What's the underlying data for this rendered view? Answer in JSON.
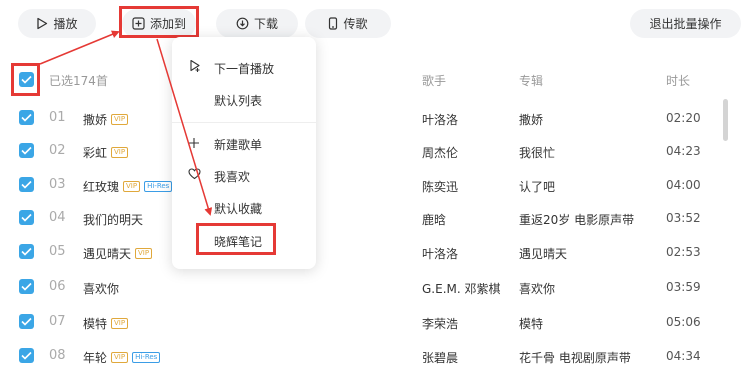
{
  "toolbar": {
    "play_label": "播放",
    "add_label": "添加到",
    "download_label": "下载",
    "send_label": "传歌",
    "exit_label": "退出批量操作"
  },
  "header": {
    "selected_label": "已选174首",
    "singer": "歌手",
    "album": "专辑",
    "duration": "时长"
  },
  "songs": [
    {
      "index": "01",
      "title": "撒娇",
      "tags": [
        "VIP"
      ],
      "singer": "叶洛洛",
      "album": "撒娇",
      "duration": "02:20"
    },
    {
      "index": "02",
      "title": "彩虹",
      "tags": [
        "VIP"
      ],
      "singer": "周杰伦",
      "album": "我很忙",
      "duration": "04:23"
    },
    {
      "index": "03",
      "title": "红玫瑰",
      "tags": [
        "VIP",
        "Hi-Res"
      ],
      "singer": "陈奕迅",
      "album": "认了吧",
      "duration": "04:00"
    },
    {
      "index": "04",
      "title": "我们的明天",
      "tags": [],
      "singer": "鹿晗",
      "album": "重返20岁 电影原声带",
      "duration": "03:52"
    },
    {
      "index": "05",
      "title": "遇见晴天",
      "tags": [
        "VIP"
      ],
      "singer": "叶洛洛",
      "album": "遇见晴天",
      "duration": "02:53"
    },
    {
      "index": "06",
      "title": "喜欢你",
      "tags": [],
      "singer": "G.E.M. 邓紫棋",
      "album": "喜欢你",
      "duration": "03:59"
    },
    {
      "index": "07",
      "title": "模特",
      "tags": [
        "VIP"
      ],
      "singer": "李荣浩",
      "album": "模特",
      "duration": "05:06"
    },
    {
      "index": "08",
      "title": "年轮",
      "tags": [
        "VIP",
        "Hi-Res"
      ],
      "singer": "张碧晨",
      "album": "花千骨 电视剧原声带",
      "duration": "04:34"
    }
  ],
  "menu": {
    "next_play": "下一首播放",
    "default_list": "默认列表",
    "new_playlist": "新建歌单",
    "favorites": "我喜欢",
    "default_collection": "默认收藏",
    "notes": "晓辉笔记"
  },
  "colors": {
    "accent": "#3ba6e6",
    "highlight": "#e53935",
    "vip": "#e0a83b",
    "hires": "#3b9de6"
  },
  "icons": [
    "play-icon",
    "add-box-icon",
    "download-icon",
    "phone-icon",
    "check-icon",
    "play-next-icon",
    "plus-icon",
    "heart-icon"
  ]
}
